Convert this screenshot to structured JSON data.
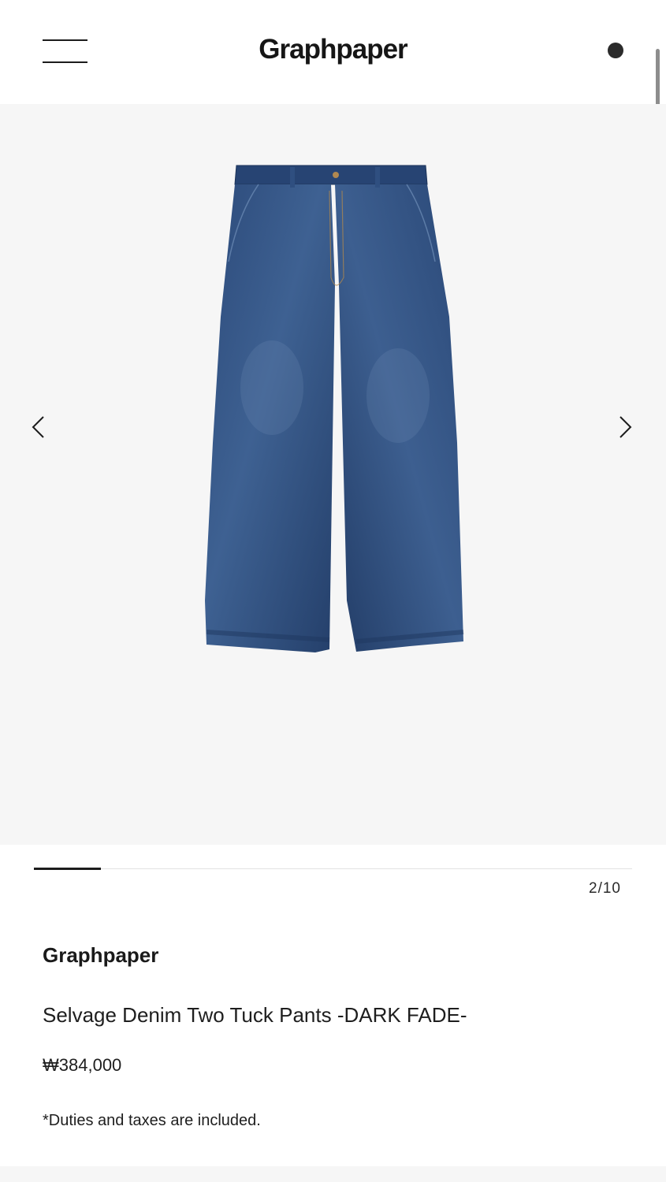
{
  "header": {
    "logo": "Graphpaper",
    "menu_icon": "hamburger-menu-icon",
    "status_icon": "dot-icon"
  },
  "gallery": {
    "current": 2,
    "total": 10,
    "counter_text": "2/10",
    "image_alt": "Selvage Denim Two Tuck Pants -DARK FADE-",
    "prev_icon": "chevron-left-icon",
    "next_icon": "chevron-right-icon"
  },
  "product": {
    "brand": "Graphpaper",
    "title": "Selvage Denim Two Tuck Pants -DARK FADE-",
    "price": "₩384,000",
    "tax_note": "*Duties and taxes are included."
  },
  "colors": {
    "background": "#ffffff",
    "gallery_bg": "#f6f6f6",
    "text": "#1c1c1c",
    "denim_dark": "#26406a",
    "denim_mid": "#37578a"
  }
}
